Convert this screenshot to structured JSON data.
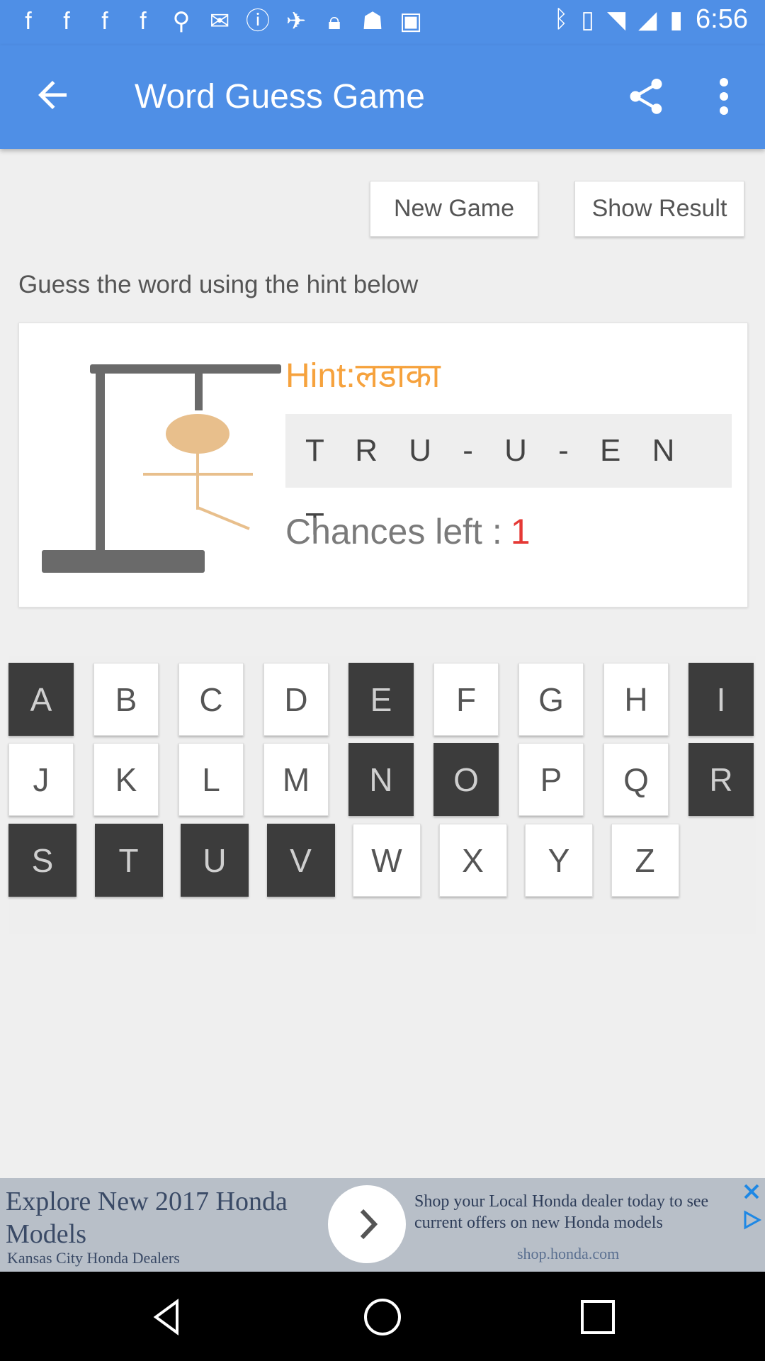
{
  "status_bar": {
    "time": "6:56",
    "left_icons": [
      "facebook-icon",
      "facebook-icon",
      "facebook-icon",
      "facebook-icon",
      "keyhole-icon",
      "mail-icon",
      "alert-icon",
      "satellite-icon",
      "lock-icon",
      "android-icon",
      "inbox-icon"
    ],
    "right_icons": [
      "bluetooth-icon",
      "vibrate-icon",
      "wifi-icon",
      "signal-icon",
      "battery-icon"
    ]
  },
  "app_bar": {
    "title": "Word Guess Game",
    "bg_color": "#4f8fe6"
  },
  "buttons": {
    "new_game": "New Game",
    "show_result": "Show Result"
  },
  "instruction": "Guess the word using the hint below",
  "game": {
    "hint": "Hint:लडाका",
    "word_pattern": "T R U - U - E N T",
    "chances_label": "Chances left :",
    "chances_left": "1"
  },
  "keyboard": {
    "rows": [
      [
        {
          "letter": "A",
          "used": true
        },
        {
          "letter": "B",
          "used": false
        },
        {
          "letter": "C",
          "used": false
        },
        {
          "letter": "D",
          "used": false
        },
        {
          "letter": "E",
          "used": true
        },
        {
          "letter": "F",
          "used": false
        },
        {
          "letter": "G",
          "used": false
        },
        {
          "letter": "H",
          "used": false
        },
        {
          "letter": "I",
          "used": true
        }
      ],
      [
        {
          "letter": "J",
          "used": false
        },
        {
          "letter": "K",
          "used": false
        },
        {
          "letter": "L",
          "used": false
        },
        {
          "letter": "M",
          "used": false
        },
        {
          "letter": "N",
          "used": true
        },
        {
          "letter": "O",
          "used": true
        },
        {
          "letter": "P",
          "used": false
        },
        {
          "letter": "Q",
          "used": false
        },
        {
          "letter": "R",
          "used": true
        }
      ],
      [
        {
          "letter": "S",
          "used": true
        },
        {
          "letter": "T",
          "used": true
        },
        {
          "letter": "U",
          "used": true
        },
        {
          "letter": "V",
          "used": true
        },
        {
          "letter": "W",
          "used": false
        },
        {
          "letter": "X",
          "used": false
        },
        {
          "letter": "Y",
          "used": false
        },
        {
          "letter": "Z",
          "used": false
        }
      ]
    ]
  },
  "ad": {
    "headline": "Explore New 2017 Honda Models",
    "advertiser": "Kansas City Honda Dealers",
    "body": "Shop your Local Honda dealer today to see current offers on new Honda models",
    "domain": "shop.honda.com"
  },
  "colors": {
    "accent": "#4f8fe6",
    "hint": "#f6a23d",
    "chances_count": "#e53935",
    "key_used": "#3c3c3c"
  }
}
